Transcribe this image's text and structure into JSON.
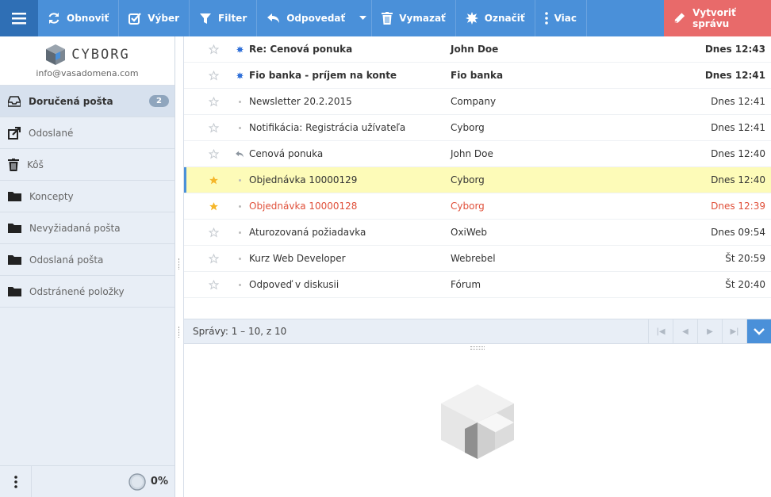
{
  "toolbar": {
    "refresh": "Obnoviť",
    "select": "Výber",
    "filter": "Filter",
    "reply": "Odpovedať",
    "delete": "Vymazať",
    "mark": "Označiť",
    "more": "Viac",
    "compose": "Vytvoriť správu",
    "colors": {
      "bar": "#4a90d9",
      "menu": "#2f6fb5",
      "compose": "#e86a6a"
    }
  },
  "account": {
    "logo": "CYBORG",
    "email": "info@vasadomena.com"
  },
  "folders": [
    {
      "label": "Doručená pošta",
      "count": "2",
      "icon": "inbox-icon"
    },
    {
      "label": "Odoslané",
      "icon": "sent-icon"
    },
    {
      "label": "Kôš",
      "icon": "trash-icon"
    },
    {
      "label": "Koncepty",
      "icon": "folder-icon"
    },
    {
      "label": "Nevyžiadaná pošta",
      "icon": "folder-icon"
    },
    {
      "label": "Odoslaná pošta",
      "icon": "folder-icon"
    },
    {
      "label": "Odstránené položky",
      "icon": "folder-icon"
    }
  ],
  "quota": {
    "value": "0%",
    "percent": 0
  },
  "messages": [
    {
      "subject": "Re: Cenová ponuka",
      "from": "John Doe",
      "date": "Dnes 12:43",
      "unread": true,
      "flagged": false,
      "status": "unread-icon"
    },
    {
      "subject": "Fio banka - príjem na konte",
      "from": "Fio banka",
      "date": "Dnes 12:41",
      "unread": true,
      "flagged": false,
      "status": "unread-icon"
    },
    {
      "subject": "Newsletter 20.2.2015",
      "from": "Company",
      "date": "Dnes 12:41",
      "unread": false,
      "flagged": false,
      "status": "read-icon"
    },
    {
      "subject": "Notifikácia: Registrácia užívateľa",
      "from": "Cyborg",
      "date": "Dnes 12:41",
      "unread": false,
      "flagged": false,
      "status": "read-icon"
    },
    {
      "subject": "Cenová ponuka",
      "from": "John Doe",
      "date": "Dnes 12:40",
      "unread": false,
      "flagged": false,
      "status": "replied-icon"
    },
    {
      "subject": "Objednávka 10000129",
      "from": "Cyborg",
      "date": "Dnes 12:40",
      "unread": false,
      "flagged": true,
      "selected": true,
      "status": "read-icon"
    },
    {
      "subject": "Objednávka 10000128",
      "from": "Cyborg",
      "date": "Dnes 12:39",
      "unread": false,
      "flagged": true,
      "status": "read-icon"
    },
    {
      "subject": "Aturozovaná požiadavka",
      "from": "OxiWeb",
      "date": "Dnes 09:54",
      "unread": false,
      "flagged": false,
      "status": "read-icon"
    },
    {
      "subject": "Kurz Web Developer",
      "from": "Webrebel",
      "date": "Št 20:59",
      "unread": false,
      "flagged": false,
      "status": "read-icon"
    },
    {
      "subject": "Odpoveď v diskusii",
      "from": "Fórum",
      "date": "Št 20:40",
      "unread": false,
      "flagged": false,
      "status": "read-icon"
    }
  ],
  "pager": {
    "text": "Správy: 1 – 10, z 10"
  }
}
